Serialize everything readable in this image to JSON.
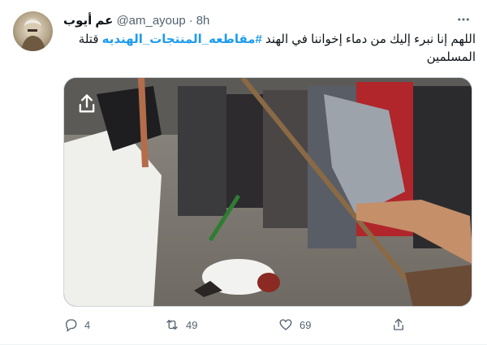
{
  "tweet": {
    "display_name": "عم أيوب",
    "handle": "@am_ayoup",
    "separator": "·",
    "time": "8h",
    "more_icon": "more-horizontal-icon",
    "text_before": "اللهم إنا نبرء إليك من دماء إخواننا في الهند ",
    "hashtag": "#مقاطعه_المنتجات_الهنديه",
    "text_after": " قتلة المسلمين",
    "media_icon": "share-icon"
  },
  "actions": {
    "reply_count": "4",
    "retweet_count": "49",
    "like_count": "69",
    "reply_icon": "reply-icon",
    "retweet_icon": "retweet-icon",
    "like_icon": "heart-icon",
    "share_icon": "share-icon"
  },
  "colors": {
    "link": "#1d9bf0",
    "muted": "#536471",
    "text": "#0f1419",
    "border": "#cfd9de"
  }
}
